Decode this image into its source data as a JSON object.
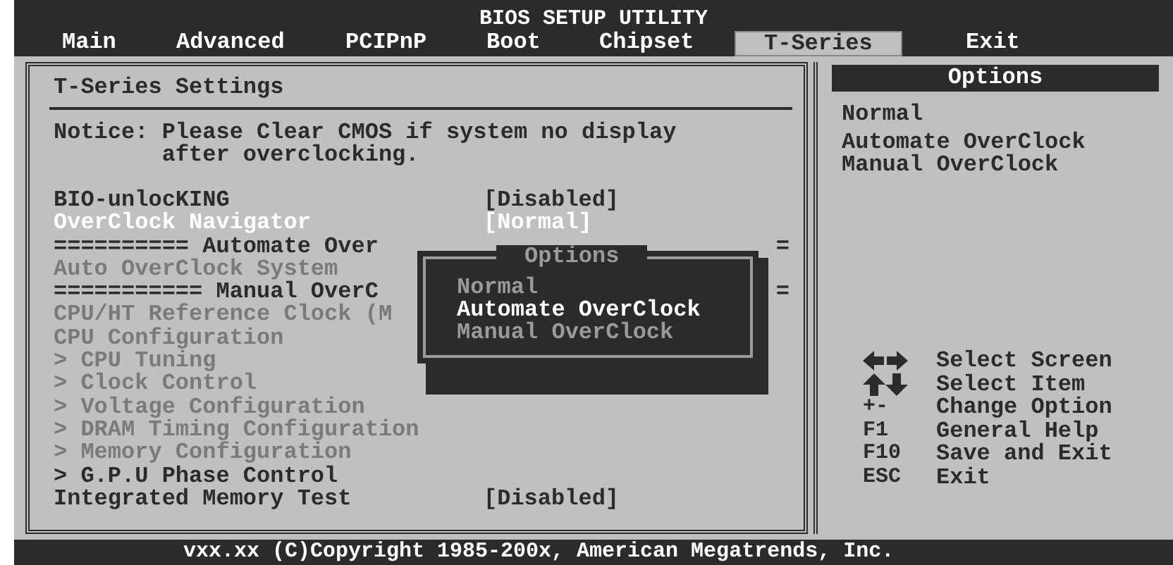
{
  "window": {
    "title": "BIOS SETUP UTILITY"
  },
  "tabs": [
    {
      "label": "Main",
      "selected": false
    },
    {
      "label": "Advanced",
      "selected": false
    },
    {
      "label": "PCIPnP",
      "selected": false
    },
    {
      "label": "Boot",
      "selected": false
    },
    {
      "label": "Chipset",
      "selected": false
    },
    {
      "label": "T-Series",
      "selected": true
    },
    {
      "label": "Exit",
      "selected": false
    }
  ],
  "settings": {
    "title": "T-Series Settings",
    "notice": [
      "Notice: Please Clear CMOS if system no display",
      "        after overclocking."
    ],
    "items": [
      {
        "kind": "setting",
        "label": "BIO-unlocKING",
        "value": "[Disabled]",
        "selected": false,
        "disabled": false
      },
      {
        "kind": "setting",
        "label": "OverClock Navigator",
        "value": "[Normal]",
        "selected": true,
        "disabled": false
      },
      {
        "kind": "separator",
        "label": "========== Automate Over",
        "tail": "="
      },
      {
        "kind": "setting",
        "label": "Auto OverClock System",
        "selected": false,
        "disabled": true
      },
      {
        "kind": "separator",
        "label": "=========== Manual OverC",
        "tail": "="
      },
      {
        "kind": "setting",
        "label": "CPU/HT Reference Clock (M",
        "selected": false,
        "disabled": true
      },
      {
        "kind": "setting",
        "label": "CPU Configuration",
        "selected": false,
        "disabled": true
      },
      {
        "kind": "submenu",
        "label": "> CPU Tuning",
        "selected": false,
        "disabled": true
      },
      {
        "kind": "submenu",
        "label": "> Clock Control",
        "selected": false,
        "disabled": true
      },
      {
        "kind": "submenu",
        "label": "> Voltage Configuration",
        "selected": false,
        "disabled": true
      },
      {
        "kind": "submenu",
        "label": "> DRAM Timing Configuration",
        "selected": false,
        "disabled": true
      },
      {
        "kind": "submenu",
        "label": "> Memory Configuration",
        "selected": false,
        "disabled": true
      },
      {
        "kind": "submenu",
        "label": "> G.P.U Phase Control",
        "selected": false,
        "disabled": false
      },
      {
        "kind": "setting",
        "label": "Integrated Memory Test",
        "value": "[Disabled]",
        "selected": false,
        "disabled": false
      }
    ]
  },
  "popup": {
    "title": "Options",
    "options": [
      {
        "label": "Normal",
        "selected": false
      },
      {
        "label": "Automate OverClock",
        "selected": true
      },
      {
        "label": "Manual OverClock",
        "selected": false
      }
    ]
  },
  "help": {
    "title": "Options",
    "lines": [
      "Normal",
      "Automate OverClock",
      "Manual OverClock"
    ],
    "keys": [
      {
        "kind": "arrows-horizontal",
        "text": "Select Screen"
      },
      {
        "kind": "arrows-vertical",
        "text": "Select Item"
      },
      {
        "kind": "key",
        "key": "+-",
        "text": "Change Option"
      },
      {
        "kind": "key",
        "key": "F1",
        "text": "General Help"
      },
      {
        "kind": "key",
        "key": "F10",
        "text": "Save and Exit"
      },
      {
        "kind": "key",
        "key": "ESC",
        "text": "Exit"
      }
    ]
  },
  "footer": "vxx.xx (C)Copyright 1985-200x, American Megatrends, Inc."
}
